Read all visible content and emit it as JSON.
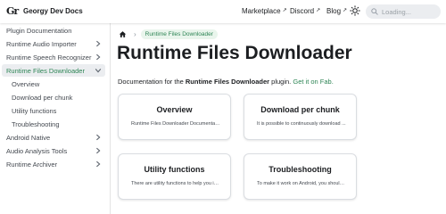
{
  "navbar": {
    "logo_text": "Gr",
    "brand": "Georgy Dev Docs",
    "links": [
      {
        "label": "Marketplace"
      },
      {
        "label": "Discord"
      },
      {
        "label": "Blog"
      }
    ],
    "search_placeholder": "Loading..."
  },
  "sidebar": {
    "items": [
      {
        "label": "Plugin Documentation",
        "chevron": false,
        "active": false
      },
      {
        "label": "Runtime Audio Importer",
        "chevron": "right",
        "active": false
      },
      {
        "label": "Runtime Speech Recognizer",
        "chevron": "right",
        "active": false
      },
      {
        "label": "Runtime Files Downloader",
        "chevron": "down",
        "active": true
      },
      {
        "label": "Android Native",
        "chevron": "right",
        "active": false
      },
      {
        "label": "Audio Analysis Tools",
        "chevron": "right",
        "active": false
      },
      {
        "label": "Runtime Archiver",
        "chevron": "right",
        "active": false
      }
    ],
    "subitems": [
      {
        "label": "Overview"
      },
      {
        "label": "Download per chunk"
      },
      {
        "label": "Utility functions"
      },
      {
        "label": "Troubleshooting"
      }
    ]
  },
  "breadcrumb": {
    "current": "Runtime Files Downloader"
  },
  "page": {
    "title": "Runtime Files Downloader",
    "intro_prefix": "Documentation for the ",
    "intro_bold": "Runtime Files Downloader",
    "intro_middle": " plugin. ",
    "intro_link": "Get it on Fab."
  },
  "cards": [
    {
      "title": "Overview",
      "description": "Runtime Files Downloader Documentation"
    },
    {
      "title": "Download per chunk",
      "description": "It is possible to continuously download ..."
    },
    {
      "title": "Utility functions",
      "description": "There are utility functions to help you int..."
    },
    {
      "title": "Troubleshooting",
      "description": "To make it work on Android, you should ..."
    }
  ],
  "colors": {
    "accent": "#2e8555",
    "active_bg": "#ebedf0",
    "badge_bg": "#e9f5ec"
  }
}
